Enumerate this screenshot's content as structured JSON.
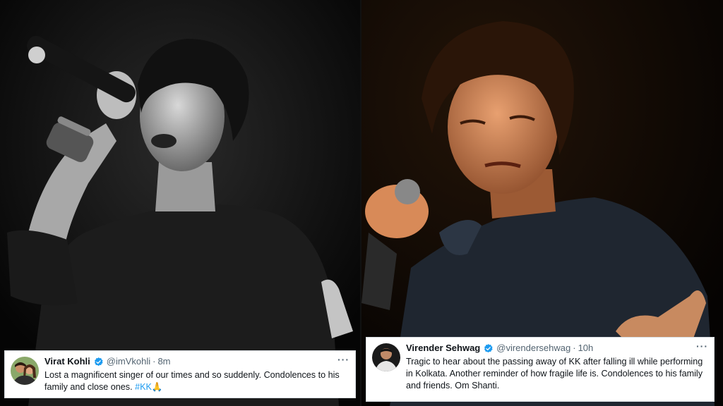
{
  "tweets": [
    {
      "name": "Virat Kohli",
      "handle": "@imVkohli",
      "separator": "·",
      "time": "8m",
      "text": "Lost a magnificent singer of our times and so suddenly. Condolences to his family and close ones.",
      "hashtag": "#KK",
      "emoji": "🙏",
      "more_icon": "more-icon",
      "verified_icon": "verified-badge-icon"
    },
    {
      "name": "Virender Sehwag",
      "handle": "@virendersehwag",
      "separator": "·",
      "time": "10h",
      "text": "Tragic to hear about the passing away of KK after falling ill while performing in Kolkata. Another reminder of how fragile life is. Condolences to his family and friends. Om Shanti.",
      "more_icon": "more-icon",
      "verified_icon": "verified-badge-icon"
    }
  ],
  "colors": {
    "verified": "#1d9bf0",
    "hashtag": "#1d9bf0",
    "secondary_text": "#536471"
  }
}
